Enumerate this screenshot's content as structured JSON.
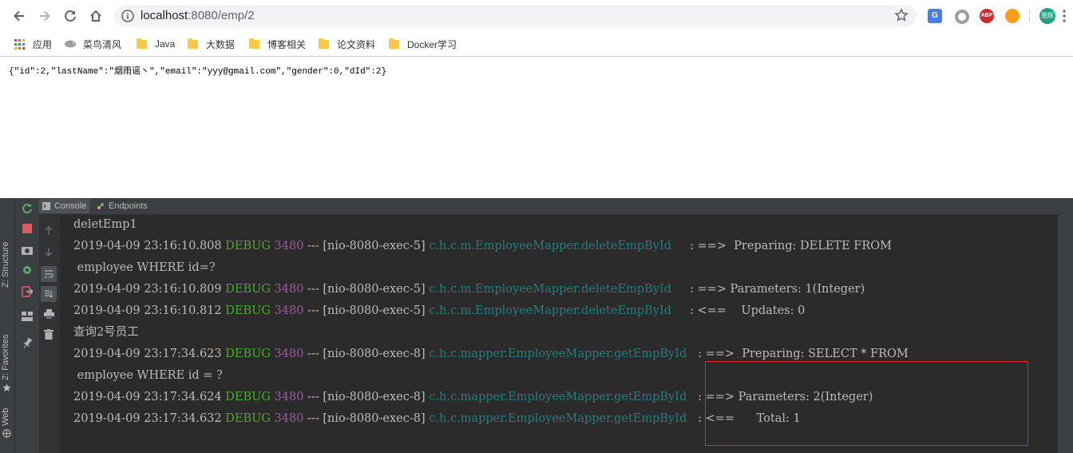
{
  "browser": {
    "url_host": "localhost",
    "url_path": ":8080/emp/2",
    "bookmarks": [
      {
        "label": "应用"
      },
      {
        "label": "菜鸟清风"
      },
      {
        "label": "Java"
      },
      {
        "label": "大数据"
      },
      {
        "label": "博客相关"
      },
      {
        "label": "论文资料"
      },
      {
        "label": "Docker学习"
      }
    ],
    "avatar_text": "朋辉",
    "ext_translate": "G",
    "ext_abp": "ABP"
  },
  "page": {
    "json_text": "{\"id\":2,\"lastName\":\"烟雨谣丶\",\"email\":\"yyy@gmail.com\",\"gender\":0,\"dId\":2}"
  },
  "ide": {
    "tabs": [
      {
        "label": "Console"
      },
      {
        "label": "Endpoints"
      }
    ],
    "left_labels": {
      "structure": "Z: Structure",
      "favorites": "2: Favorites",
      "web": "Web"
    },
    "console_lines": [
      {
        "text": "deletEmp1"
      },
      {
        "ts": "2019-04-09 23:16:10.808",
        "level": "DEBUG",
        "pid": "3480",
        "thread": "--- [nio-8080-exec-5]",
        "logger": "c.h.c.m.EmployeeMapper.deleteEmpById    ",
        "msg": " : ==>  Preparing: DELETE FROM"
      },
      {
        "text": " employee WHERE id=?"
      },
      {
        "ts": "2019-04-09 23:16:10.809",
        "level": "DEBUG",
        "pid": "3480",
        "thread": "--- [nio-8080-exec-5]",
        "logger": "c.h.c.m.EmployeeMapper.deleteEmpById    ",
        "msg": " : ==> Parameters: 1(Integer)"
      },
      {
        "ts": "2019-04-09 23:16:10.812",
        "level": "DEBUG",
        "pid": "3480",
        "thread": "--- [nio-8080-exec-5]",
        "logger": "c.h.c.m.EmployeeMapper.deleteEmpById    ",
        "msg": " : <==    Updates: 0"
      },
      {
        "text": "查询2号员工"
      },
      {
        "ts": "2019-04-09 23:17:34.623",
        "level": "DEBUG",
        "pid": "3480",
        "thread": "--- [nio-8080-exec-8]",
        "logger": "c.h.c.mapper.EmployeeMapper.getEmpById  ",
        "msg": " : ==>  Preparing: SELECT * FROM"
      },
      {
        "text": " employee WHERE id = ?"
      },
      {
        "ts": "2019-04-09 23:17:34.624",
        "level": "DEBUG",
        "pid": "3480",
        "thread": "--- [nio-8080-exec-8]",
        "logger": "c.h.c.mapper.EmployeeMapper.getEmpById  ",
        "msg": " : ==> Parameters: 2(Integer)"
      },
      {
        "ts": "2019-04-09 23:17:34.632",
        "level": "DEBUG",
        "pid": "3480",
        "thread": "--- [nio-8080-exec-8]",
        "logger": "c.h.c.mapper.EmployeeMapper.getEmpById  ",
        "msg": " : <==      Total: 1"
      }
    ],
    "colors": {
      "debug": "#4ca82f",
      "pid": "#9a5b9c",
      "logger": "#287b7e",
      "highlight": "#e0282e"
    }
  }
}
